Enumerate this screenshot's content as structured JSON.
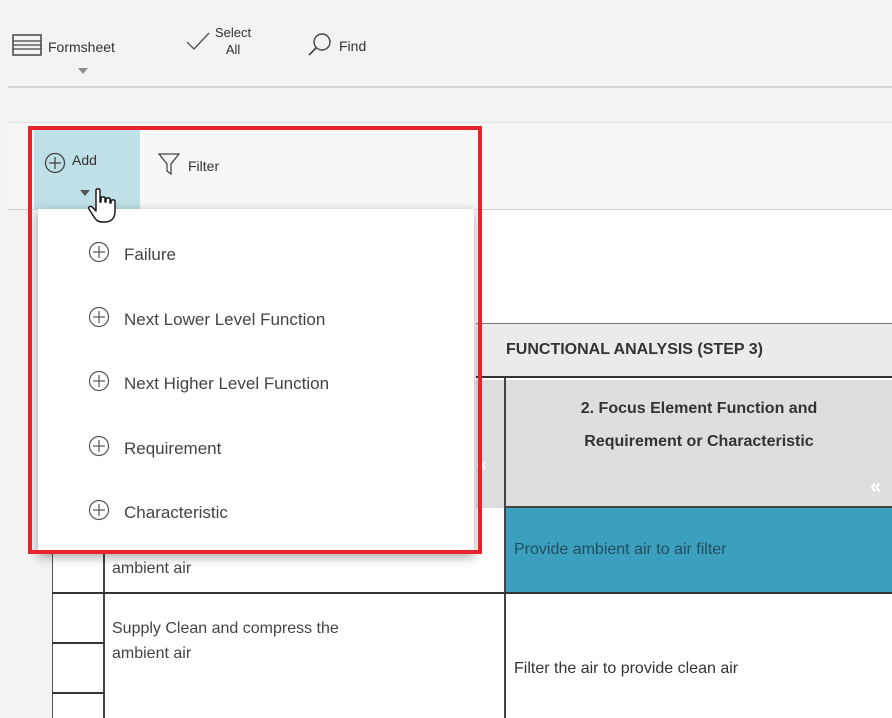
{
  "toolbar": {
    "formsheet_label": "Formsheet",
    "select_label_line1": "Select",
    "select_label_line2": "All",
    "find_label": "Find"
  },
  "actionbar": {
    "add_label": "Add",
    "filter_label": "Filter"
  },
  "add_menu": {
    "items": [
      {
        "label": "Failure"
      },
      {
        "label": "Next Lower Level Function"
      },
      {
        "label": "Next Higher Level Function"
      },
      {
        "label": "Requirement"
      },
      {
        "label": "Characteristic"
      }
    ]
  },
  "table": {
    "section_header": "FUNCTIONAL ANALYSIS (STEP 3)",
    "focus_header_line1": "2. Focus Element Function and",
    "focus_header_line2": "Requirement or Characteristic",
    "rows": [
      {
        "left": "ambient air",
        "right": "Provide ambient air to air filter"
      },
      {
        "left_line1": "Supply Clean and compress the",
        "left_line2": "ambient air",
        "right": "Filter the air to provide clean air"
      }
    ]
  },
  "colors": {
    "highlight": "#e8232b",
    "selected_cell": "#3c9fbd",
    "add_active": "#bfe0e6"
  }
}
